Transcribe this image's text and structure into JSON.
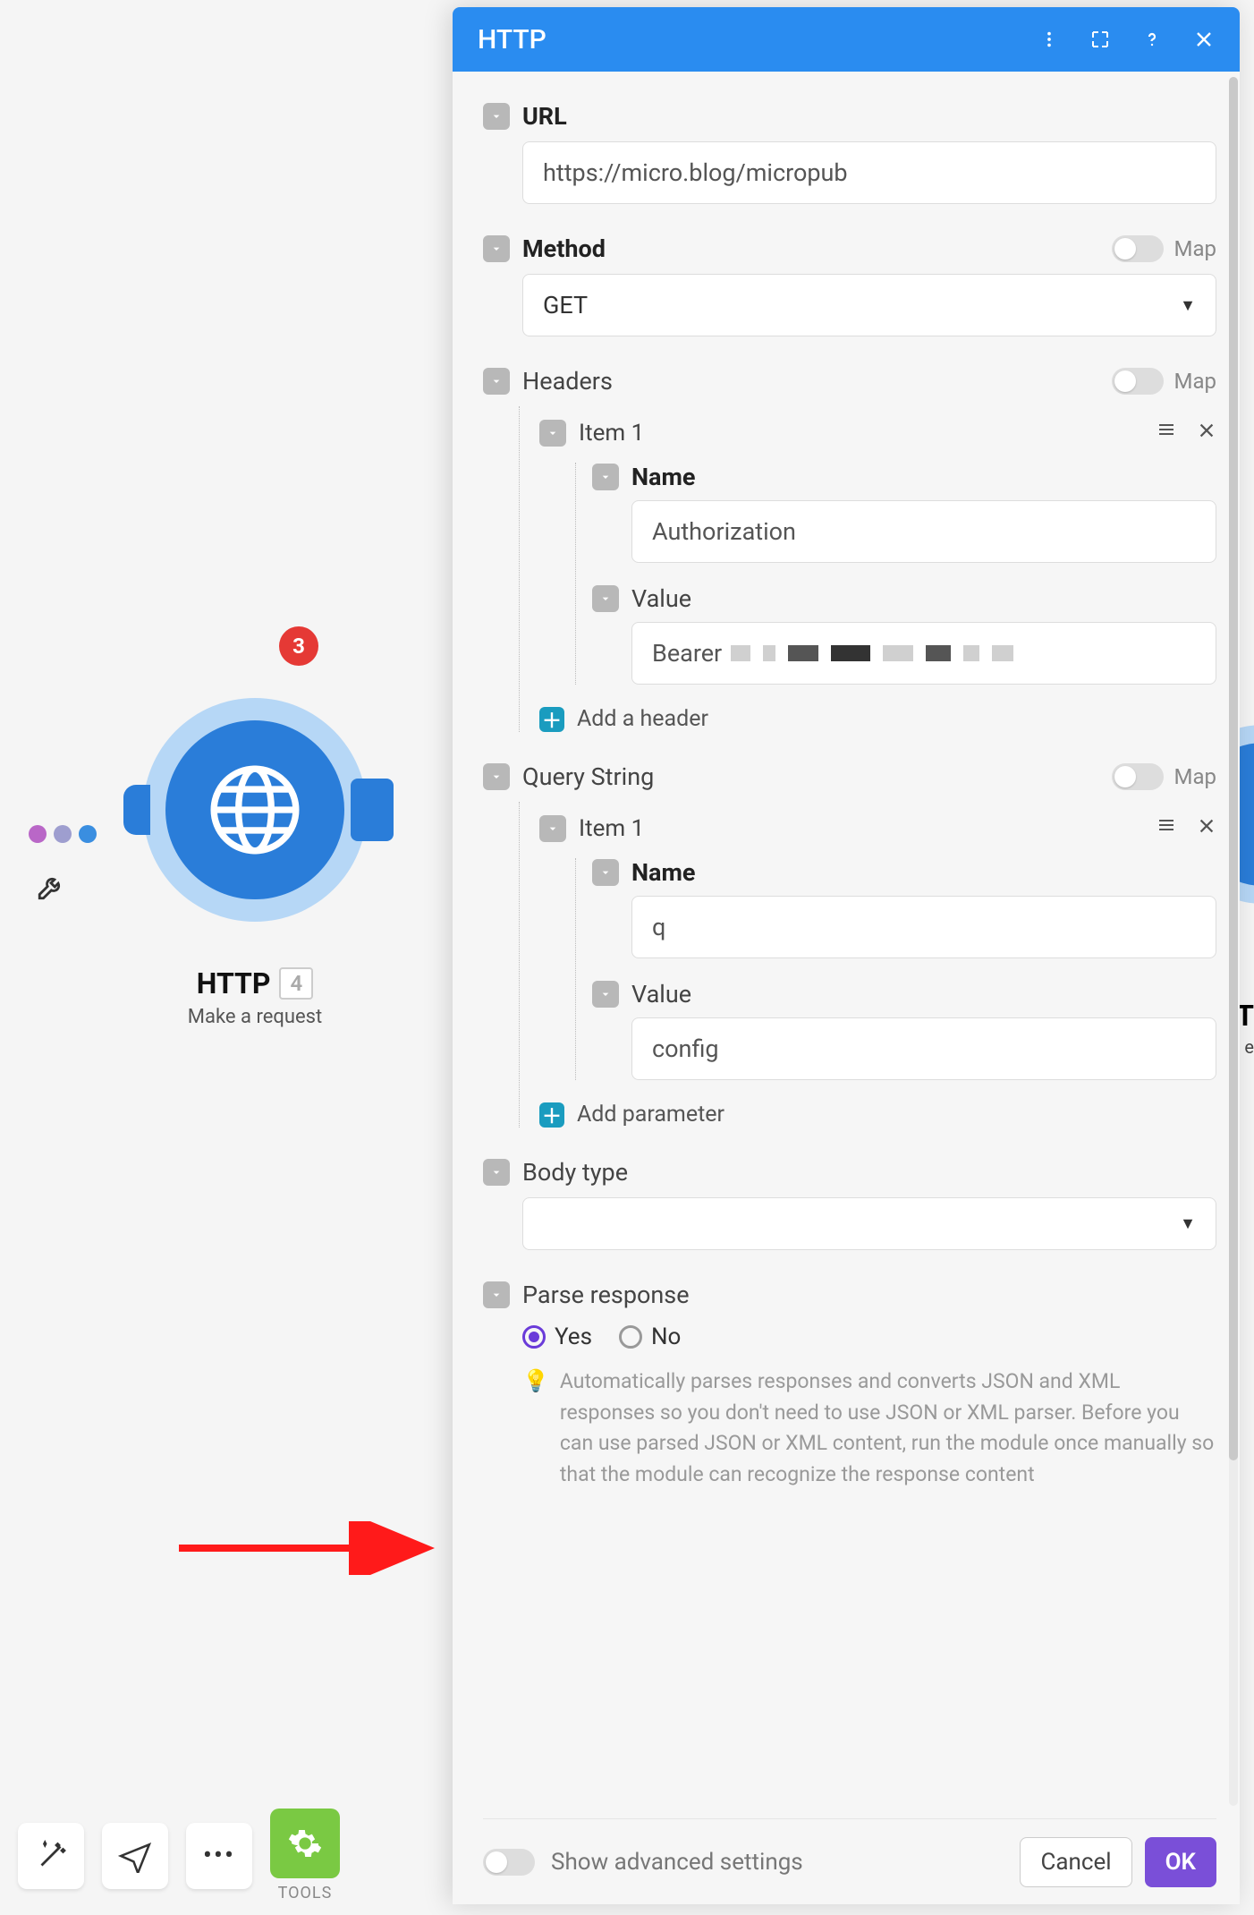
{
  "canvas": {
    "node": {
      "title": "HTTP",
      "badge": "4",
      "subtitle": "Make a request",
      "count_badge": "3"
    },
    "peek": {
      "title_fragment": "T",
      "sub_fragment": "e"
    },
    "toolbar": {
      "tools_label": "TOOLS"
    }
  },
  "panel": {
    "title": "HTTP",
    "fields": {
      "url": {
        "label": "URL",
        "value": "https://micro.blog/micropub"
      },
      "method": {
        "label": "Method",
        "value": "GET",
        "map_label": "Map"
      },
      "headers": {
        "label": "Headers",
        "map_label": "Map",
        "item_label": "Item 1",
        "name_label": "Name",
        "name_value": "Authorization",
        "value_label": "Value",
        "value_prefix": "Bearer",
        "add_label": "Add a header"
      },
      "query": {
        "label": "Query String",
        "map_label": "Map",
        "item_label": "Item 1",
        "name_label": "Name",
        "name_value": "q",
        "value_label": "Value",
        "value_value": "config",
        "add_label": "Add parameter"
      },
      "body_type": {
        "label": "Body type",
        "value": ""
      },
      "parse": {
        "label": "Parse response",
        "yes": "Yes",
        "no": "No",
        "hint": "Automatically parses responses and converts JSON and XML responses so you don't need to use JSON or XML parser. Before you can use parsed JSON or XML content, run the module once manually so that the module can recognize the response content"
      }
    },
    "footer": {
      "advanced": "Show advanced settings",
      "cancel": "Cancel",
      "ok": "OK"
    }
  }
}
